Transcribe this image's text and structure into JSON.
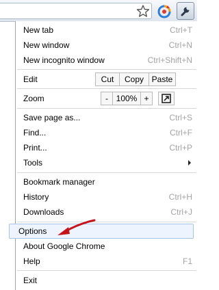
{
  "toolbar": {
    "star_icon": "star-icon",
    "extension_icon": "extension-icon",
    "wrench_icon": "wrench-icon"
  },
  "menu": {
    "new_tab": {
      "label": "New tab",
      "shortcut": "Ctrl+T"
    },
    "new_window": {
      "label": "New window",
      "shortcut": "Ctrl+N"
    },
    "new_incognito": {
      "label": "New incognito window",
      "shortcut": "Ctrl+Shift+N"
    },
    "edit": {
      "label": "Edit",
      "cut": "Cut",
      "copy": "Copy",
      "paste": "Paste"
    },
    "zoom": {
      "label": "Zoom",
      "minus": "-",
      "level": "100%",
      "plus": "+"
    },
    "save_page": {
      "label": "Save page as...",
      "shortcut": "Ctrl+S"
    },
    "find": {
      "label": "Find...",
      "shortcut": "Ctrl+F"
    },
    "print": {
      "label": "Print...",
      "shortcut": "Ctrl+P"
    },
    "tools": {
      "label": "Tools"
    },
    "bookmark_manager": {
      "label": "Bookmark manager"
    },
    "history": {
      "label": "History",
      "shortcut": "Ctrl+H"
    },
    "downloads": {
      "label": "Downloads",
      "shortcut": "Ctrl+J"
    },
    "options": {
      "label": "Options"
    },
    "about": {
      "label": "About Google Chrome"
    },
    "help": {
      "label": "Help",
      "shortcut": "F1"
    },
    "exit": {
      "label": "Exit"
    }
  },
  "colors": {
    "highlight_bg": "#eef4fd",
    "highlight_border": "#a5c4ec",
    "arrow": "#c4151c",
    "shortcut_text": "#a3a3a3"
  }
}
